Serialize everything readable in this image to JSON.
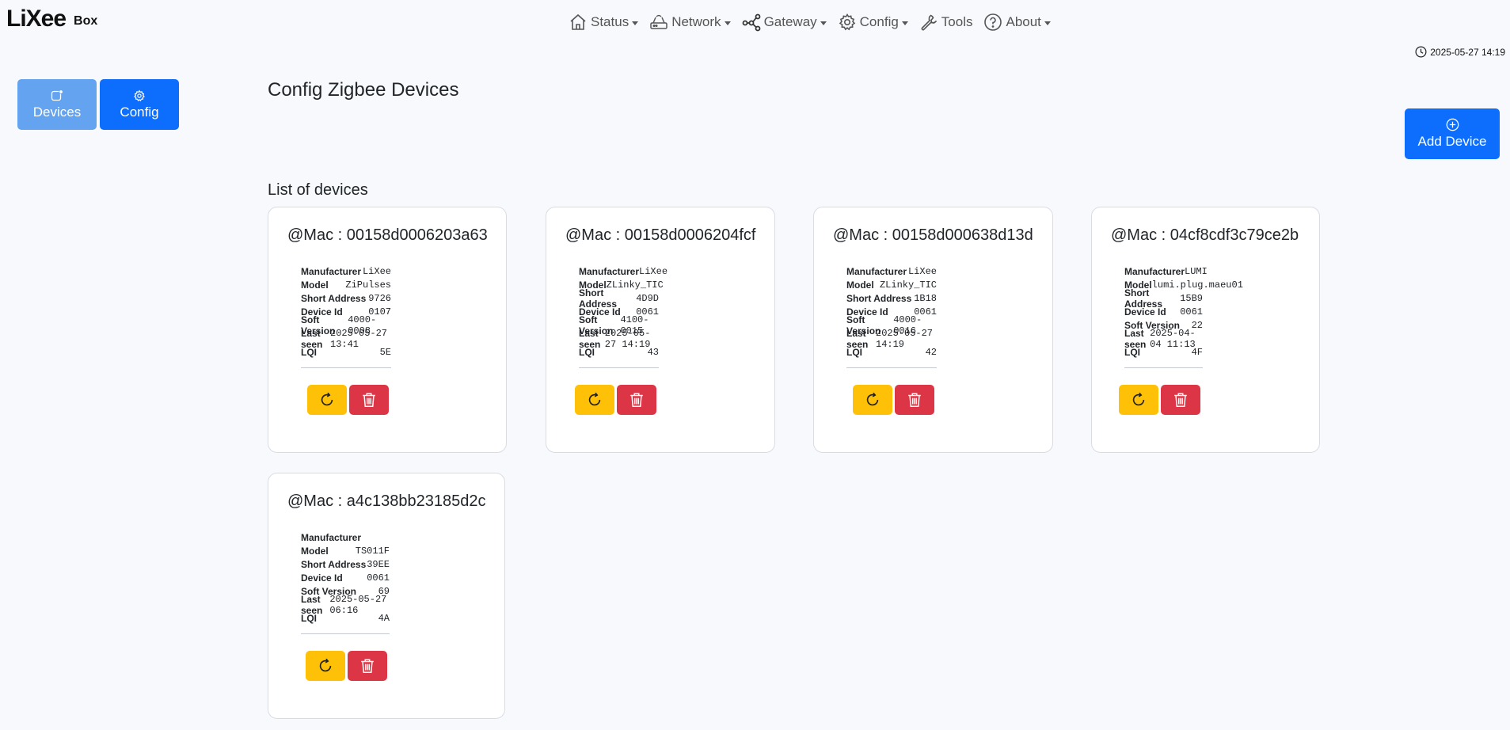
{
  "brand": {
    "logo": "LiXee",
    "suffix": "Box"
  },
  "nav": [
    {
      "label": "Status",
      "icon": "house-icon"
    },
    {
      "label": "Network",
      "icon": "router-icon"
    },
    {
      "label": "Gateway",
      "icon": "share-icon"
    },
    {
      "label": "Config",
      "icon": "gear-icon"
    },
    {
      "label": "Tools",
      "icon": "wrench-icon"
    },
    {
      "label": "About",
      "icon": "question-circle-icon"
    }
  ],
  "clock": "2025-05-27 14:19",
  "sidebar": {
    "devices_label": "Devices",
    "config_label": "Config"
  },
  "page": {
    "title": "Config Zigbee Devices",
    "list_title": "List of devices",
    "add_label": "Add Device"
  },
  "field_labels": [
    "Manufacturer",
    "Model",
    "Short Address",
    "Device Id",
    "Soft Version",
    "Last seen",
    "LQI"
  ],
  "devices": [
    {
      "mac": "@Mac : 00158d0006203a63",
      "manufacturer": "LiXee",
      "model": "ZiPulses",
      "short_address": "9726",
      "device_id": "0107",
      "soft_version": "4000-0008",
      "last_seen": "2025-05-27 13:41",
      "lqi": "5E"
    },
    {
      "mac": "@Mac : 00158d0006204fcf",
      "manufacturer": "LiXee",
      "model": "ZLinky_TIC",
      "short_address": "4D9D",
      "device_id": "0061",
      "soft_version": "4100-0015",
      "last_seen": "2025-05-27 14:19",
      "lqi": "43"
    },
    {
      "mac": "@Mac : 00158d000638d13d",
      "manufacturer": "LiXee",
      "model": "ZLinky_TIC",
      "short_address": "1B18",
      "device_id": "0061",
      "soft_version": "4000-0016",
      "last_seen": "2025-05-27 14:19",
      "lqi": "42"
    },
    {
      "mac": "@Mac : 04cf8cdf3c79ce2b",
      "manufacturer": "LUMI",
      "model": "lumi.plug.maeu01",
      "short_address": "15B9",
      "device_id": "0061",
      "soft_version": "22",
      "last_seen": "2025-04-04 11:13",
      "lqi": "4F"
    },
    {
      "mac": "@Mac : a4c138bb23185d2c",
      "manufacturer": "",
      "model": "TS011F",
      "short_address": "39EE",
      "device_id": "0061",
      "soft_version": "69",
      "last_seen": "2025-05-27 06:16",
      "lqi": "4A"
    }
  ],
  "colors": {
    "primary": "#0d6efd",
    "active_light": "#64a3ef",
    "warning": "#ffc107",
    "danger": "#dc3545"
  }
}
